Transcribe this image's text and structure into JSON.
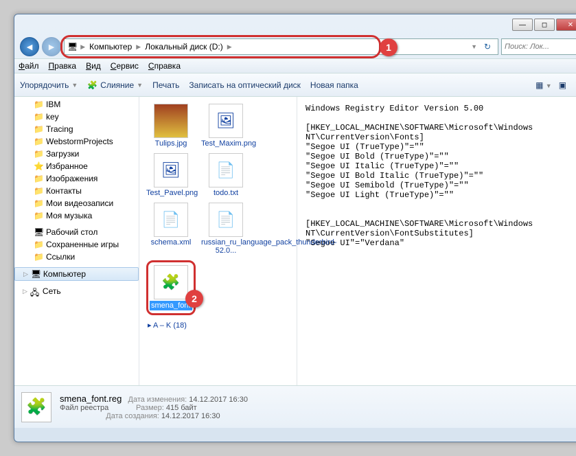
{
  "callouts": {
    "c1": "1",
    "c2": "2"
  },
  "nav": {
    "computer": "Компьютер",
    "disk": "Локальный диск (D:)"
  },
  "search": {
    "placeholder": "Поиск: Лок..."
  },
  "menu": {
    "file": "Файл",
    "edit": "Правка",
    "view": "Вид",
    "service": "Сервис",
    "help": "Справка"
  },
  "toolbar": {
    "organize": "Упорядочить",
    "merge": "Слияние",
    "print": "Печать",
    "burn": "Записать на оптический диск",
    "newfolder": "Новая папка"
  },
  "sidebar": {
    "items": [
      {
        "label": "IBM"
      },
      {
        "label": "key"
      },
      {
        "label": "Tracing"
      },
      {
        "label": "WebstormProjects"
      },
      {
        "label": "Загрузки"
      },
      {
        "label": "Избранное"
      },
      {
        "label": "Изображения"
      },
      {
        "label": "Контакты"
      },
      {
        "label": "Мои видеозаписи"
      },
      {
        "label": "Моя музыка"
      },
      {
        "label": "Рабочий стол"
      },
      {
        "label": "Сохраненные игры"
      },
      {
        "label": "Ссылки"
      }
    ],
    "computer": "Компьютер",
    "network": "Сеть"
  },
  "files": {
    "tulips": "Tulips.jpg",
    "testmax": "Test_Maxim.png",
    "testpavel": "Test_Pavel.png",
    "todo": "todo.txt",
    "schema": "schema.xml",
    "russian": "russian_ru_language_pack_thunderbird-52.0...",
    "smena": "smena_font.reg",
    "group": "▸ A – K (18)"
  },
  "preview": "Windows Registry Editor Version 5.00\n\n[HKEY_LOCAL_MACHINE\\SOFTWARE\\Microsoft\\Windows NT\\CurrentVersion\\Fonts]\n\"Segoe UI (TrueType)\"=\"\"\n\"Segoe UI Bold (TrueType)\"=\"\"\n\"Segoe UI Italic (TrueType)\"=\"\"\n\"Segoe UI Bold Italic (TrueType)\"=\"\"\n\"Segoe UI Semibold (TrueType)\"=\"\"\n\"Segoe UI Light (TrueType)\"=\"\"\n\n\n[HKEY_LOCAL_MACHINE\\SOFTWARE\\Microsoft\\Windows NT\\CurrentVersion\\FontSubstitutes]\n\"Segoe UI\"=\"Verdana\"",
  "details": {
    "name": "smena_font.reg",
    "type": "Файл реестра",
    "mod_k": "Дата изменения:",
    "mod_v": "14.12.2017 16:30",
    "size_k": "Размер:",
    "size_v": "415 байт",
    "created_k": "Дата создания:",
    "created_v": "14.12.2017 16:30"
  }
}
